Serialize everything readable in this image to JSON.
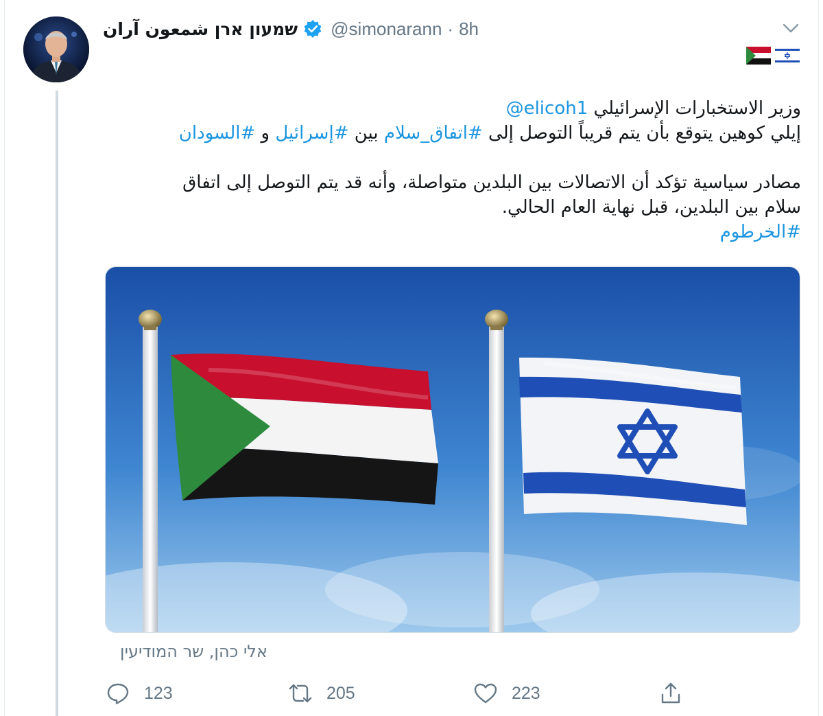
{
  "tweet": {
    "author": {
      "display_name": "שמעון ארן شمعون آران",
      "handle": "@simonarann",
      "separator": "·",
      "time": "8h",
      "verified": true
    },
    "flag_emojis": [
      "israel-flag",
      "sudan-flag"
    ],
    "body": {
      "line1_prefix": "وزير الاستخبارات الإسرائيلي",
      "line1_mention": "@elicoh1",
      "line2_text_a": "إيلي كوهين يتوقع بأن يتم قريباً التوصل إلى",
      "line2_hashtag_1": "#اتفاق_سلام",
      "line2_text_b": "بين",
      "line2_hashtag_2": "#إسرائيل",
      "line2_text_c": "و",
      "line2_hashtag_3": "#السودان",
      "para2_line1": "مصادر سياسية تؤكد أن الاتصالات بين البلدين متواصلة، وأنه قد يتم التوصل إلى اتفاق",
      "para2_line2": "سلام بين البلدين، قبل نهاية العام الحالي.",
      "hashtag_4": "#الخرطوم"
    },
    "media": {
      "description_icons": [
        "sudan-flag",
        "israel-flag"
      ]
    },
    "caption": "אלי כהן, שר המודיעין",
    "actions": {
      "replies": "123",
      "retweets": "205",
      "likes": "223"
    },
    "colors": {
      "accent": "#1b95e0",
      "muted": "#657786",
      "verified": "#1da1f2",
      "sudan_red": "#c8102e",
      "sudan_green": "#2e8b3e",
      "israel_blue": "#1f4fb6"
    }
  }
}
